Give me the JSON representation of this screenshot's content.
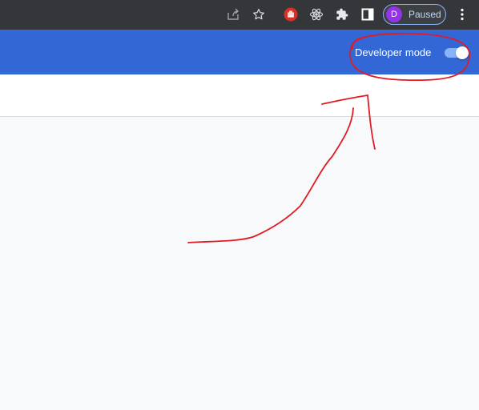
{
  "toolbar": {
    "icons": [
      "share-icon",
      "bookmark-star-icon",
      "hand-extension-icon",
      "react-devtools-icon",
      "puzzle-extensions-icon",
      "side-panel-icon",
      "more-menu-icon"
    ],
    "profile": {
      "initial": "D",
      "status": "Paused",
      "avatar_color": "#9334e6"
    }
  },
  "header": {
    "background": "#3367d6",
    "developer_mode_label": "Developer mode",
    "developer_mode_on": true
  },
  "annotation": {
    "color": "#e11b22"
  }
}
